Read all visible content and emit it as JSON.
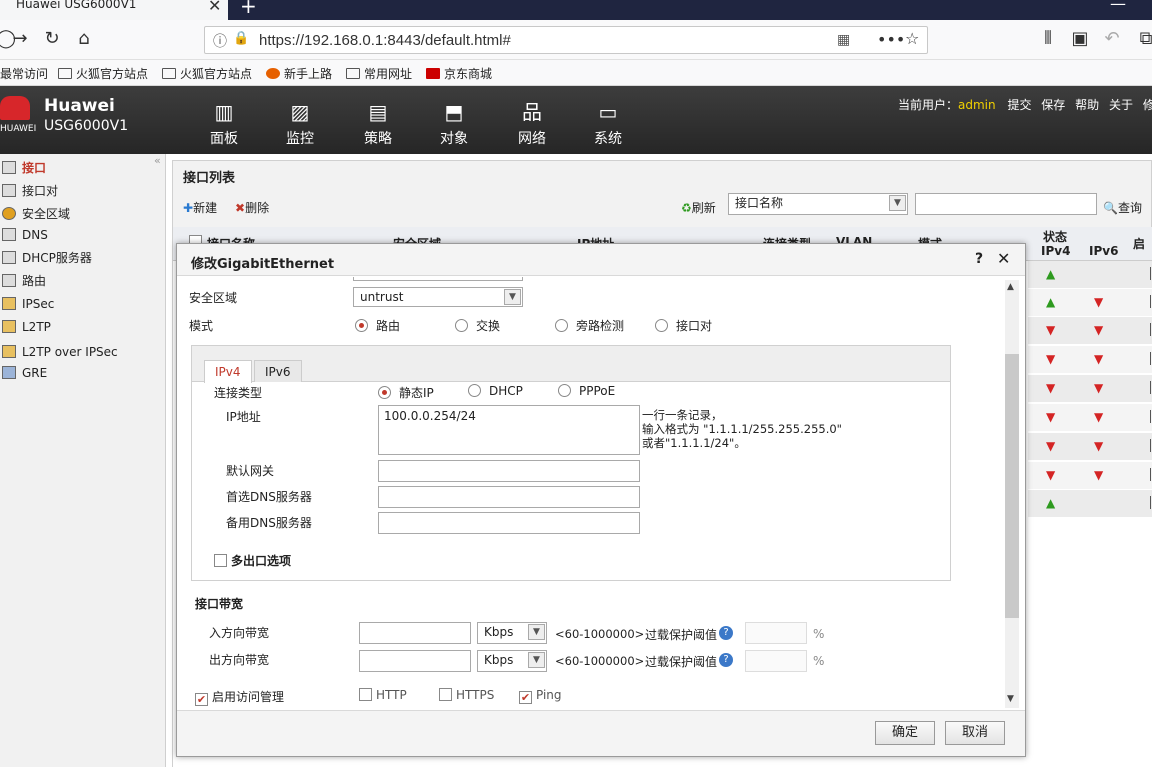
{
  "browser": {
    "tab_title": "Huawei USG6000V1",
    "url": "https://192.168.0.1:8443/default.html#",
    "bookmarks": [
      "最常访问",
      "火狐官方站点",
      "火狐官方站点",
      "新手上路",
      "常用网址",
      "京东商城"
    ]
  },
  "app": {
    "brand": "Huawei",
    "model": "USG6000V1",
    "logo_text": "HUAWEI",
    "modules": [
      "面板",
      "监控",
      "策略",
      "对象",
      "网络",
      "系统"
    ],
    "current_user_label": "当前用户：",
    "current_user": "admin",
    "actions": [
      "提交",
      "保存",
      "帮助",
      "关于",
      "修改"
    ]
  },
  "sidebar": {
    "items": [
      "接口",
      "接口对",
      "安全区域",
      "DNS",
      "DHCP服务器",
      "路由",
      "IPSec",
      "L2TP",
      "L2TP over IPSec",
      "GRE"
    ]
  },
  "list": {
    "title": "接口列表",
    "new_label": "新建",
    "delete_label": "删除",
    "refresh_label": "刷新",
    "search_field": "接口名称",
    "search_label": "查询",
    "columns": [
      "接口名称",
      "安全区域",
      "IP地址",
      "连接类型",
      "VLAN",
      "模式",
      "状态"
    ],
    "status_sub": [
      "IPv4",
      "IPv6"
    ],
    "extra_col": "启",
    "status_rows": [
      {
        "ipv4": "up",
        "ipv6": ""
      },
      {
        "ipv4": "up",
        "ipv6": "down"
      },
      {
        "ipv4": "down",
        "ipv6": "down"
      },
      {
        "ipv4": "down",
        "ipv6": "down"
      },
      {
        "ipv4": "down",
        "ipv6": "down"
      },
      {
        "ipv4": "down",
        "ipv6": "down"
      },
      {
        "ipv4": "down",
        "ipv6": "down"
      },
      {
        "ipv4": "down",
        "ipv6": "down"
      },
      {
        "ipv4": "up",
        "ipv6": ""
      }
    ]
  },
  "dialog": {
    "title": "修改GigabitEthernet",
    "help": "?",
    "close": "✕",
    "zone_label": "安全区域",
    "zone_value": "untrust",
    "mode_label": "模式",
    "modes": [
      "路由",
      "交换",
      "旁路检测",
      "接口对"
    ],
    "tabs": [
      "IPv4",
      "IPv6"
    ],
    "conn_type_label": "连接类型",
    "conn_types": [
      "静态IP",
      "DHCP",
      "PPPoE"
    ],
    "ip_label": "IP地址",
    "ip_value": "100.0.0.254/24",
    "ip_hint": [
      "一行一条记录，",
      "输入格式为 \"1.1.1.1/255.255.255.0\"",
      "或者\"1.1.1.1/24\"。"
    ],
    "gateway_label": "默认网关",
    "dns1_label": "首选DNS服务器",
    "dns2_label": "备用DNS服务器",
    "multi_exit_label": "多出口选项",
    "bandwidth_title": "接口带宽",
    "in_bw_label": "入方向带宽",
    "out_bw_label": "出方向带宽",
    "bw_unit": "Kbps",
    "bw_range": "<60-1000000>",
    "overload_label": "过载保护阈值",
    "percent": "%",
    "access_mgmt_label": "启用访问管理",
    "protocols": [
      {
        "name": "HTTP",
        "checked": false
      },
      {
        "name": "HTTPS",
        "checked": false
      },
      {
        "name": "Ping",
        "checked": true
      }
    ],
    "ok_label": "确定",
    "cancel_label": "取消"
  },
  "colors": {
    "accent": "#c0392b",
    "header": "#2b2b2b",
    "user": "#f0d000"
  }
}
